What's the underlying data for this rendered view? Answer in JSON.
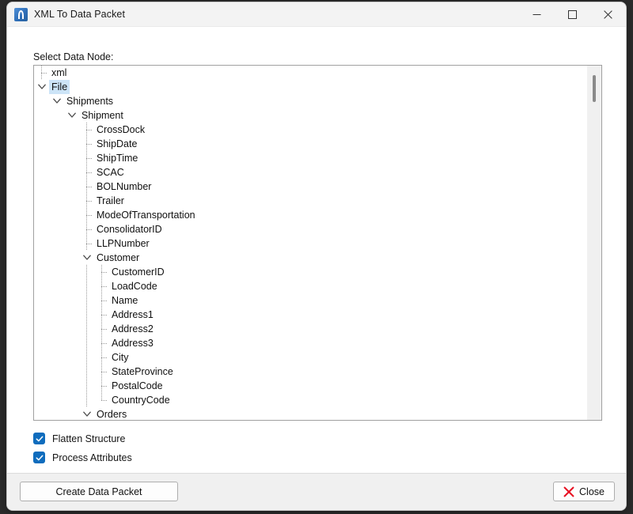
{
  "window": {
    "title": "XML To Data Packet",
    "icon": "app-icon",
    "controls": {
      "minimize": "minimize-icon",
      "maximize": "maximize-icon",
      "close": "close-icon"
    }
  },
  "main": {
    "tree_label": "Select Data Node:",
    "tree": [
      {
        "label": "xml",
        "level": 1,
        "expander": "none",
        "selected": false
      },
      {
        "label": "File",
        "level": 1,
        "expander": "expanded",
        "selected": true
      },
      {
        "label": "Shipments",
        "level": 2,
        "expander": "expanded",
        "selected": false
      },
      {
        "label": "Shipment",
        "level": 3,
        "expander": "expanded",
        "selected": false
      },
      {
        "label": "CrossDock",
        "level": 4,
        "expander": "none",
        "selected": false
      },
      {
        "label": "ShipDate",
        "level": 4,
        "expander": "none",
        "selected": false
      },
      {
        "label": "ShipTime",
        "level": 4,
        "expander": "none",
        "selected": false
      },
      {
        "label": "SCAC",
        "level": 4,
        "expander": "none",
        "selected": false
      },
      {
        "label": "BOLNumber",
        "level": 4,
        "expander": "none",
        "selected": false
      },
      {
        "label": "Trailer",
        "level": 4,
        "expander": "none",
        "selected": false
      },
      {
        "label": "ModeOfTransportation",
        "level": 4,
        "expander": "none",
        "selected": false
      },
      {
        "label": "ConsolidatorID",
        "level": 4,
        "expander": "none",
        "selected": false
      },
      {
        "label": "LLPNumber",
        "level": 4,
        "expander": "none",
        "selected": false
      },
      {
        "label": "Customer",
        "level": 4,
        "expander": "expanded",
        "selected": false
      },
      {
        "label": "CustomerID",
        "level": 5,
        "expander": "none",
        "selected": false
      },
      {
        "label": "LoadCode",
        "level": 5,
        "expander": "none",
        "selected": false
      },
      {
        "label": "Name",
        "level": 5,
        "expander": "none",
        "selected": false
      },
      {
        "label": "Address1",
        "level": 5,
        "expander": "none",
        "selected": false
      },
      {
        "label": "Address2",
        "level": 5,
        "expander": "none",
        "selected": false
      },
      {
        "label": "Address3",
        "level": 5,
        "expander": "none",
        "selected": false
      },
      {
        "label": "City",
        "level": 5,
        "expander": "none",
        "selected": false
      },
      {
        "label": "StateProvince",
        "level": 5,
        "expander": "none",
        "selected": false
      },
      {
        "label": "PostalCode",
        "level": 5,
        "expander": "none",
        "selected": false
      },
      {
        "label": "CountryCode",
        "level": 5,
        "expander": "none",
        "selected": false
      },
      {
        "label": "Orders",
        "level": 4,
        "expander": "expanded",
        "selected": false
      }
    ],
    "scrollbar": {
      "name": "tree-vertical-scrollbar"
    },
    "options": [
      {
        "label": "Flatten Structure",
        "checked": true
      },
      {
        "label": "Process Attributes",
        "checked": true
      }
    ]
  },
  "footer": {
    "create_label": "Create Data Packet",
    "close_label": "Close",
    "close_icon": "red-x-icon"
  },
  "colors": {
    "accent": "#0f6cbd",
    "selection": "#cce4f7",
    "close_red": "#e81123",
    "titlebar": "#f3f3f3",
    "footer": "#f0f0f0"
  }
}
